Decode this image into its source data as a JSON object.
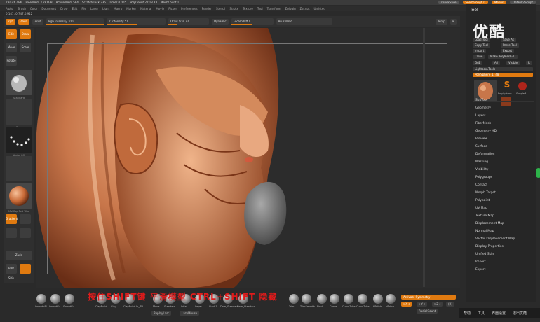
{
  "titlebar": {
    "left": "ZBrush 4R6",
    "items": [
      "Free Mem 3.281GB",
      "Active Mem 584",
      "Scratch Disk 336",
      "Timer 0.005",
      "PolyCount 2.013 KP",
      "MeshCount 1"
    ],
    "quicksave": "QuickSave",
    "see_through": "See-through 0",
    "menus_btn": "Menus",
    "script": "DefaultZScript"
  },
  "menubar": [
    "Alpha",
    "Brush",
    "Color",
    "Document",
    "Draw",
    "Edit",
    "File",
    "Layer",
    "Light",
    "Macro",
    "Marker",
    "Material",
    "Movie",
    "Picker",
    "Preferences",
    "Render",
    "Stencil",
    "Stroke",
    "Texture",
    "Tool",
    "Transform",
    "Zplugin",
    "Zscript",
    "Unlisted"
  ],
  "statusline": "0.147,-0.747,0.912",
  "topshelf": {
    "rgb": "Rgb",
    "zadd": "Zadd",
    "zsub": "Zsub",
    "rgb_intensity": "Rgb Intensity 100",
    "z_intensity": "Z Intensity 51",
    "draw_size": "Draw Size 72",
    "focal_shift": "Focal Shift 0",
    "dynamic": "Dynamic",
    "brushmod": "BrushMod",
    "persp": "Persp"
  },
  "lefttray": {
    "edit": "Edit",
    "draw": "Draw",
    "move": "Move",
    "scale": "Scale",
    "rotate": "Rotate",
    "brush_label": "Standard",
    "stroke_label": "Dots",
    "alpha_label": "Alpha Off",
    "texture_label": "Texture Off",
    "material_label": "MatCap Red Wax",
    "gradient": "Gradient",
    "bpr": "BPR SPix",
    "zadd2": "Zadd"
  },
  "bottomshelf": {
    "brushes": [
      "SmoothPl",
      "SmoothV",
      "SmoothV",
      "ClayBuild",
      "Clay",
      "ClayBuildUp_ZD",
      "Move",
      "Standard",
      "Inflat",
      "Layer",
      "Slash1",
      "Dam_Standard",
      "Dam_Standard",
      "Trim",
      "TrimSmooth",
      "Pinch",
      "Curve",
      "CurveTube",
      "CurveTube",
      "hPolish",
      "hPolish",
      "Move"
    ],
    "replay_last": "ReplayLast",
    "lazy_mouse": "LazyMouse",
    "activate_symmetry": "Activate Symmetry",
    "symx": ">X<",
    "symy": ">Y<",
    "symz": ">Z<",
    "radial": "(R)",
    "radial_count": "RadialCount"
  },
  "hint": "按住SHIFT键 平滑模型 CTRL+SHIFT 隐藏",
  "rightpanel": {
    "title": "Tool",
    "logo": "优酷",
    "buttons": [
      "Load Tool",
      "Save As",
      "Copy Tool",
      "Paste Tool",
      "Import",
      "Export",
      "Clone",
      "Make PolyMesh3D",
      "GoZ",
      "All",
      "Visible",
      "R"
    ],
    "lightbox": "Lightbox▸Tools",
    "current_tool": "PolySphere_1. 48",
    "sub_tool_labels": [
      "PolySphere",
      "SimpleB",
      "Cylinder"
    ],
    "sections": [
      "SubTool",
      "Geometry",
      "Layers",
      "FiberMesh",
      "Geometry HD",
      "Preview",
      "Surface",
      "Deformation",
      "Masking",
      "Visibility",
      "Polygroups",
      "Contact",
      "Morph Target",
      "Polypaint",
      "UV Map",
      "Texture Map",
      "Displacement Map",
      "Normal Map",
      "Vector Displacement Map",
      "Display Properties",
      "Unified Skin",
      "Import",
      "Export"
    ]
  },
  "taskbar": [
    "帮助",
    "工具",
    "界面设置",
    "退出优酷"
  ],
  "colors": {
    "accent": "#e07a10",
    "panel": "#262626",
    "bg": "#2a2a2a"
  }
}
